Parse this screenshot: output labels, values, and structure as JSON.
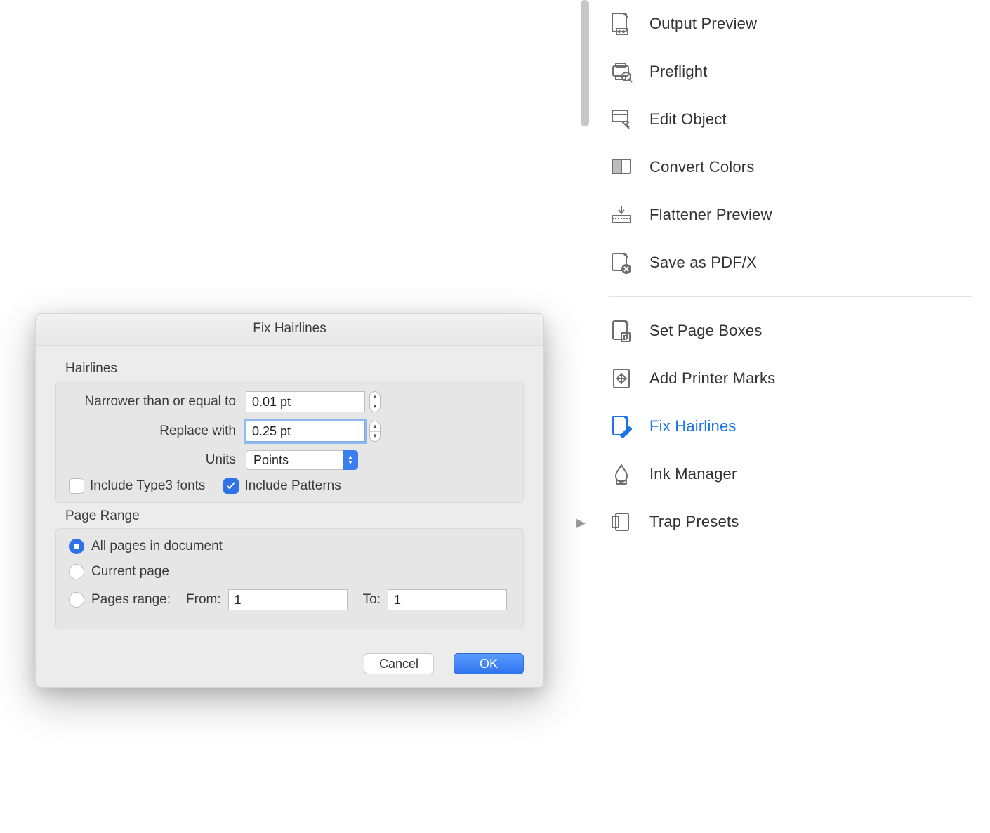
{
  "sidebar": {
    "items": [
      {
        "label": "Output Preview",
        "icon": "output-preview-icon",
        "active": false
      },
      {
        "label": "Preflight",
        "icon": "preflight-icon",
        "active": false
      },
      {
        "label": "Edit Object",
        "icon": "edit-object-icon",
        "active": false
      },
      {
        "label": "Convert Colors",
        "icon": "convert-colors-icon",
        "active": false
      },
      {
        "label": "Flattener Preview",
        "icon": "flattener-preview-icon",
        "active": false
      },
      {
        "label": "Save as PDF/X",
        "icon": "save-pdfx-icon",
        "active": false
      },
      {
        "label": "Set Page Boxes",
        "icon": "set-page-boxes-icon",
        "active": false
      },
      {
        "label": "Add Printer Marks",
        "icon": "add-printer-marks-icon",
        "active": false
      },
      {
        "label": "Fix Hairlines",
        "icon": "fix-hairlines-icon",
        "active": true
      },
      {
        "label": "Ink Manager",
        "icon": "ink-manager-icon",
        "active": false
      },
      {
        "label": "Trap Presets",
        "icon": "trap-presets-icon",
        "active": false
      }
    ]
  },
  "dialog": {
    "title": "Fix Hairlines",
    "hairlines": {
      "group_label": "Hairlines",
      "narrower_label": "Narrower than or equal to",
      "narrower_value": "0.01 pt",
      "replace_label": "Replace with",
      "replace_value": "0.25 pt",
      "units_label": "Units",
      "units_value": "Points",
      "include_type3_label": "Include Type3 fonts",
      "include_type3_checked": false,
      "include_patterns_label": "Include Patterns",
      "include_patterns_checked": true
    },
    "page_range": {
      "group_label": "Page Range",
      "all_label": "All pages in document",
      "current_label": "Current page",
      "range_label": "Pages range:",
      "from_label": "From:",
      "from_value": "1",
      "to_label": "To:",
      "to_value": "1",
      "selected": "all"
    },
    "buttons": {
      "cancel": "Cancel",
      "ok": "OK"
    }
  }
}
